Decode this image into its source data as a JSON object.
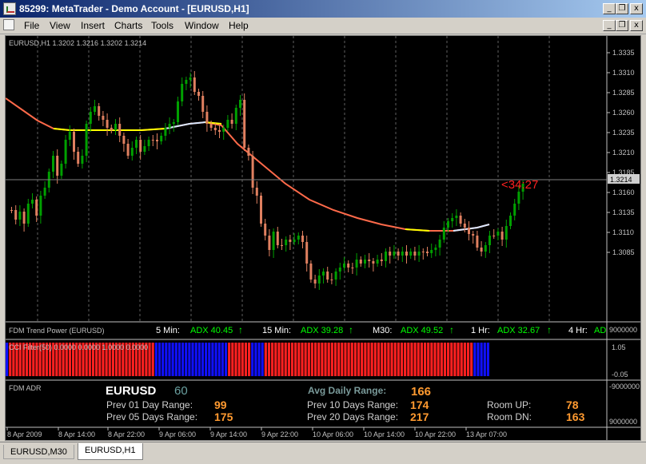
{
  "window": {
    "title": "85299: MetaTrader - Demo Account - [EURUSD,H1]"
  },
  "menu": [
    "File",
    "View",
    "Insert",
    "Charts",
    "Tools",
    "Window",
    "Help"
  ],
  "window_buttons": {
    "minimize": "_",
    "restore": "❐",
    "close": "x"
  },
  "chart": {
    "header": "EURUSD,H1  1.3202 1.3216 1.3202 1.3214",
    "y_ticks": [
      "1.3335",
      "1.3310",
      "1.3285",
      "1.3260",
      "1.3235",
      "1.3210",
      "1.3185",
      "1.3160",
      "1.3135",
      "1.3110",
      "1.3085"
    ],
    "current_price": "1.3214",
    "countdown": "<34:27",
    "x_ticks": [
      "8 Apr 2009",
      "8 Apr 14:00",
      "8 Apr 22:00",
      "9 Apr 06:00",
      "9 Apr 14:00",
      "9 Apr 22:00",
      "10 Apr 06:00",
      "10 Apr 14:00",
      "10 Apr 22:00",
      "13 Apr 07:00"
    ],
    "colors": {
      "bull": "#00a000",
      "bear": "#e08060",
      "ma": "#ff6a4a",
      "ma_flat_yellow": "#ffff00",
      "ma_flat_white": "#d8e8ff",
      "axis_text": "#c0c0c0",
      "countdown": "#ff2020"
    }
  },
  "trend_panel": {
    "title": "FDM Trend Power (EURUSD)",
    "items": [
      {
        "tf": "5 Min:",
        "adx": "ADX 40.45",
        "arrow": "↑"
      },
      {
        "tf": "15 Min:",
        "adx": "ADX 39.28",
        "arrow": "↑"
      },
      {
        "tf": "M30:",
        "adx": "ADX 49.52",
        "arrow": "↑"
      },
      {
        "tf": "1 Hr:",
        "adx": "ADX 32.67",
        "arrow": "↑"
      },
      {
        "tf": "4 Hr:",
        "adx": "AD",
        "arrow": ""
      }
    ],
    "scale": "9000000"
  },
  "cci_panel": {
    "title": "CCI Filter(50) 0.0000 0.0000 1.0000 0.0000",
    "scale_top": "1.05",
    "scale_bottom": "-0.05",
    "bars": "BRRRRRRRRRRRRRRRRRRRRRRRRRRRRRRRRRRRRRRRRRRRRBBBBBBBBBBBBBBBBBBBBBBRRRRRRRBBBBRRRRRRRRRRRRRRRRRRRRRRRRRRRRRRRRRRRRRRRRRRRRRRRRRRRRRRRRRRRRRRRBBBBB",
    "colors": {
      "R": "#ff2020",
      "B": "#1010ff"
    }
  },
  "adr_panel": {
    "title": "FDM ADR",
    "symbol": "EURUSD",
    "symbol_value": "60",
    "avg_label": "Avg Daily Range:",
    "avg_value": "166",
    "rows_left": [
      {
        "label": "Prev 01 Day Range:",
        "value": "99"
      },
      {
        "label": "Prev 05 Days Range:",
        "value": "175"
      }
    ],
    "rows_mid": [
      {
        "label": "Prev 10 Days Range:",
        "value": "174"
      },
      {
        "label": "Prev 20 Days Range:",
        "value": "217"
      }
    ],
    "rows_right": [
      {
        "label": "Room UP:",
        "value": "78"
      },
      {
        "label": "Room DN:",
        "value": "163"
      }
    ],
    "scale_top": "-9000000",
    "scale_bottom": "9000000"
  },
  "tabs": [
    {
      "label": "EURUSD,M30",
      "active": false
    },
    {
      "label": "EURUSD,H1",
      "active": true
    }
  ]
}
